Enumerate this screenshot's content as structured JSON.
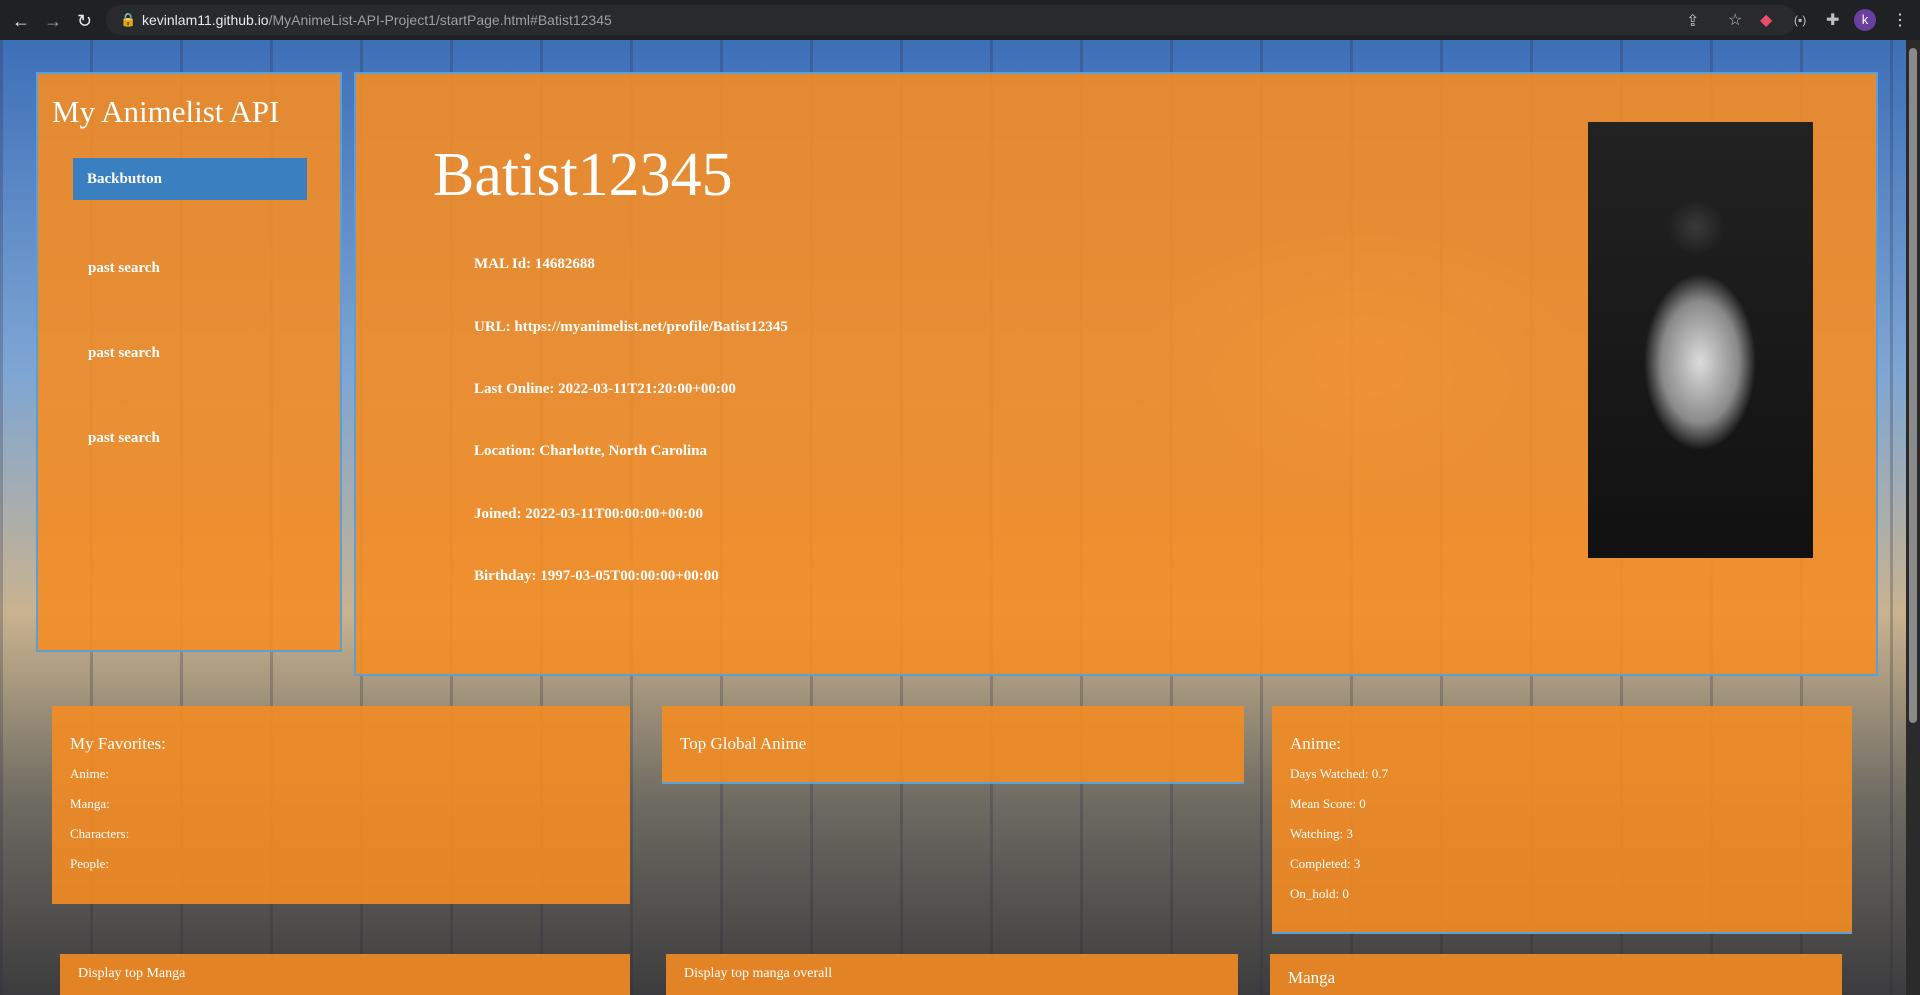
{
  "browser": {
    "url_host": "kevinlam11.github.io",
    "url_path": "/MyAnimeList-API-Project1/startPage.html#Batist12345",
    "avatar_letter": "k"
  },
  "sidebar": {
    "title": "My Animelist API",
    "back_button": "Backbutton",
    "past_searches": [
      "past search",
      "past search",
      "past search"
    ]
  },
  "profile": {
    "username": "Batist12345",
    "details": [
      "MAL Id: 14682688",
      "URL: https://myanimelist.net/profile/Batist12345",
      "Last Online: 2022-03-11T21:20:00+00:00",
      "Location: Charlotte, North Carolina",
      "Joined: 2022-03-11T00:00:00+00:00",
      "Birthday: 1997-03-05T00:00:00+00:00"
    ]
  },
  "favorites": {
    "title": "My Favorites:",
    "items": [
      "Anime:",
      "Manga:",
      "Characters:",
      "People:"
    ]
  },
  "top_global": {
    "title": "Top Global Anime"
  },
  "anime_stats": {
    "title": "Anime:",
    "items": [
      "Days Watched: 0.7",
      "Mean Score: 0",
      "Watching: 3",
      "Completed: 3",
      "On_hold: 0"
    ]
  },
  "bottom": {
    "display_top_manga": "Display top Manga",
    "display_top_manga_overall": "Display top manga overall",
    "manga_title": "Manga"
  }
}
